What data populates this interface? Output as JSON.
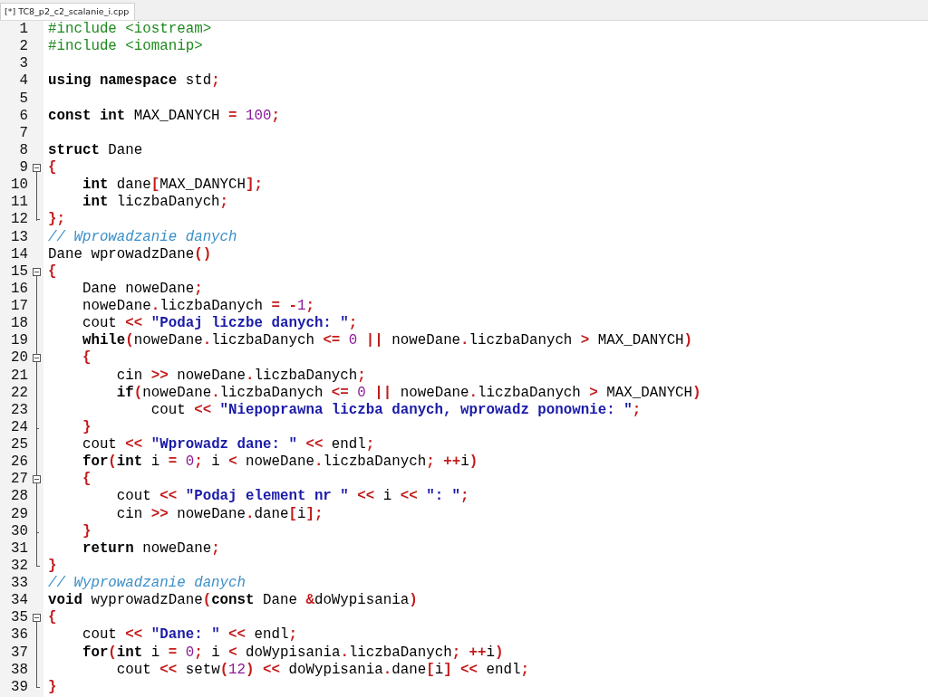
{
  "tab": {
    "title": "[*] TC8_p2_c2_scalanie_i.cpp",
    "selected": true
  },
  "lines": [
    {
      "number": "1",
      "kind": "plain",
      "tokens": [
        {
          "kind": "pre",
          "text": "#include <iostream>"
        }
      ]
    },
    {
      "number": "2",
      "kind": "plain",
      "tokens": [
        {
          "kind": "pre",
          "text": "#include <iomanip>"
        }
      ]
    },
    {
      "number": "3",
      "kind": "plain"
    },
    {
      "number": "4",
      "kind": "plain",
      "tokens": [
        {
          "kind": "kw",
          "text": "using"
        },
        {
          "kind": "kw",
          "text": " namespace"
        },
        {
          "kind": "plain",
          "text": " std"
        },
        {
          "kind": "sym",
          "text": ";"
        }
      ]
    },
    {
      "number": "5",
      "kind": "plain"
    },
    {
      "number": "6",
      "kind": "plain",
      "tokens": [
        {
          "kind": "kw",
          "text": "const"
        },
        {
          "kind": "kw",
          "text": " int"
        },
        {
          "kind": "plain",
          "text": " MAX_DANYCH "
        },
        {
          "kind": "sym",
          "text": "="
        },
        {
          "kind": "num",
          "text": " 100"
        },
        {
          "kind": "sym",
          "text": ";"
        }
      ]
    },
    {
      "number": "7",
      "kind": "plain"
    },
    {
      "number": "8",
      "kind": "plain",
      "tokens": [
        {
          "kind": "kw",
          "text": "struct"
        },
        {
          "kind": "plain",
          "text": " Dane"
        }
      ]
    },
    {
      "number": "9",
      "kind": "fold",
      "expanded": true,
      "tokens": [
        {
          "kind": "sym",
          "text": "{"
        }
      ]
    },
    {
      "number": "10",
      "kind": "inside",
      "tokens": [
        {
          "kind": "kw",
          "text": "    int"
        },
        {
          "kind": "plain",
          "text": " dane"
        },
        {
          "kind": "sym",
          "text": "["
        },
        {
          "kind": "plain",
          "text": "MAX_DANYCH"
        },
        {
          "kind": "sym",
          "text": "];"
        }
      ]
    },
    {
      "number": "11",
      "kind": "inside",
      "tokens": [
        {
          "kind": "kw",
          "text": "    int"
        },
        {
          "kind": "plain",
          "text": " liczbaDanych"
        },
        {
          "kind": "sym",
          "text": ";"
        }
      ]
    },
    {
      "number": "12",
      "kind": "close",
      "tokens": [
        {
          "kind": "sym",
          "text": "};"
        }
      ]
    },
    {
      "number": "13",
      "kind": "plain",
      "tokens": [
        {
          "kind": "com",
          "text": "// Wprowadzanie danych"
        }
      ]
    },
    {
      "number": "14",
      "kind": "plain",
      "tokens": [
        {
          "kind": "plain",
          "text": "Dane wprowadzDane"
        },
        {
          "kind": "sym",
          "text": "()"
        }
      ]
    },
    {
      "number": "15",
      "kind": "fold",
      "expanded": true,
      "tokens": [
        {
          "kind": "sym",
          "text": "{"
        }
      ]
    },
    {
      "number": "16",
      "kind": "inside",
      "tokens": [
        {
          "kind": "plain",
          "text": "    Dane noweDane"
        },
        {
          "kind": "sym",
          "text": ";"
        }
      ]
    },
    {
      "number": "17",
      "kind": "inside",
      "tokens": [
        {
          "kind": "plain",
          "text": "    noweDane"
        },
        {
          "kind": "sym",
          "text": "."
        },
        {
          "kind": "plain",
          "text": "liczbaDanych "
        },
        {
          "kind": "sym",
          "text": "="
        },
        {
          "kind": "sym",
          "text": " -"
        },
        {
          "kind": "num",
          "text": "1"
        },
        {
          "kind": "sym",
          "text": ";"
        }
      ]
    },
    {
      "number": "18",
      "kind": "inside",
      "tokens": [
        {
          "kind": "plain",
          "text": "    cout "
        },
        {
          "kind": "sym",
          "text": "<<"
        },
        {
          "kind": "str",
          "text": " \"Podaj liczbe danych: \""
        },
        {
          "kind": "sym",
          "text": ";"
        }
      ]
    },
    {
      "number": "19",
      "kind": "inside",
      "tokens": [
        {
          "kind": "kw",
          "text": "    while"
        },
        {
          "kind": "sym",
          "text": "("
        },
        {
          "kind": "plain",
          "text": "noweDane"
        },
        {
          "kind": "sym",
          "text": "."
        },
        {
          "kind": "plain",
          "text": "liczbaDanych "
        },
        {
          "kind": "sym",
          "text": "<="
        },
        {
          "kind": "num",
          "text": " 0"
        },
        {
          "kind": "sym",
          "text": " ||"
        },
        {
          "kind": "plain",
          "text": " noweDane"
        },
        {
          "kind": "sym",
          "text": "."
        },
        {
          "kind": "plain",
          "text": "liczbaDanych "
        },
        {
          "kind": "sym",
          "text": ">"
        },
        {
          "kind": "plain",
          "text": " MAX_DANYCH"
        },
        {
          "kind": "sym",
          "text": ")"
        }
      ]
    },
    {
      "number": "20",
      "kind": "subfold",
      "expanded": true,
      "tokens": [
        {
          "kind": "sym",
          "text": "    {"
        }
      ]
    },
    {
      "number": "21",
      "kind": "inside",
      "tokens": [
        {
          "kind": "plain",
          "text": "        cin "
        },
        {
          "kind": "sym",
          "text": ">>"
        },
        {
          "kind": "plain",
          "text": " noweDane"
        },
        {
          "kind": "sym",
          "text": "."
        },
        {
          "kind": "plain",
          "text": "liczbaDanych"
        },
        {
          "kind": "sym",
          "text": ";"
        }
      ]
    },
    {
      "number": "22",
      "kind": "inside",
      "tokens": [
        {
          "kind": "kw",
          "text": "        if"
        },
        {
          "kind": "sym",
          "text": "("
        },
        {
          "kind": "plain",
          "text": "noweDane"
        },
        {
          "kind": "sym",
          "text": "."
        },
        {
          "kind": "plain",
          "text": "liczbaDanych "
        },
        {
          "kind": "sym",
          "text": "<="
        },
        {
          "kind": "num",
          "text": " 0"
        },
        {
          "kind": "sym",
          "text": " ||"
        },
        {
          "kind": "plain",
          "text": " noweDane"
        },
        {
          "kind": "sym",
          "text": "."
        },
        {
          "kind": "plain",
          "text": "liczbaDanych "
        },
        {
          "kind": "sym",
          "text": ">"
        },
        {
          "kind": "plain",
          "text": " MAX_DANYCH"
        },
        {
          "kind": "sym",
          "text": ")"
        }
      ]
    },
    {
      "number": "23",
      "kind": "inside",
      "tokens": [
        {
          "kind": "plain",
          "text": "            cout "
        },
        {
          "kind": "sym",
          "text": "<<"
        },
        {
          "kind": "str",
          "text": " \"Niepoprawna liczba danych, wprowadz ponownie: \""
        },
        {
          "kind": "sym",
          "text": ";"
        }
      ]
    },
    {
      "number": "24",
      "kind": "subclose",
      "tokens": [
        {
          "kind": "sym",
          "text": "    }"
        }
      ]
    },
    {
      "number": "25",
      "kind": "inside",
      "tokens": [
        {
          "kind": "plain",
          "text": "    cout "
        },
        {
          "kind": "sym",
          "text": "<<"
        },
        {
          "kind": "str",
          "text": " \"Wprowadz dane: \""
        },
        {
          "kind": "sym",
          "text": " <<"
        },
        {
          "kind": "plain",
          "text": " endl"
        },
        {
          "kind": "sym",
          "text": ";"
        }
      ]
    },
    {
      "number": "26",
      "kind": "inside",
      "tokens": [
        {
          "kind": "kw",
          "text": "    for"
        },
        {
          "kind": "sym",
          "text": "("
        },
        {
          "kind": "kw",
          "text": "int"
        },
        {
          "kind": "plain",
          "text": " i "
        },
        {
          "kind": "sym",
          "text": "="
        },
        {
          "kind": "num",
          "text": " 0"
        },
        {
          "kind": "sym",
          "text": ";"
        },
        {
          "kind": "plain",
          "text": " i "
        },
        {
          "kind": "sym",
          "text": "<"
        },
        {
          "kind": "plain",
          "text": " noweDane"
        },
        {
          "kind": "sym",
          "text": "."
        },
        {
          "kind": "plain",
          "text": "liczbaDanych"
        },
        {
          "kind": "sym",
          "text": ";"
        },
        {
          "kind": "sym",
          "text": " ++"
        },
        {
          "kind": "plain",
          "text": "i"
        },
        {
          "kind": "sym",
          "text": ")"
        }
      ]
    },
    {
      "number": "27",
      "kind": "subfold",
      "expanded": true,
      "tokens": [
        {
          "kind": "sym",
          "text": "    {"
        }
      ]
    },
    {
      "number": "28",
      "kind": "inside",
      "tokens": [
        {
          "kind": "plain",
          "text": "        cout "
        },
        {
          "kind": "sym",
          "text": "<<"
        },
        {
          "kind": "str",
          "text": " \"Podaj element nr \""
        },
        {
          "kind": "sym",
          "text": " <<"
        },
        {
          "kind": "plain",
          "text": " i "
        },
        {
          "kind": "sym",
          "text": "<<"
        },
        {
          "kind": "str",
          "text": " \": \""
        },
        {
          "kind": "sym",
          "text": ";"
        }
      ]
    },
    {
      "number": "29",
      "kind": "inside",
      "tokens": [
        {
          "kind": "plain",
          "text": "        cin "
        },
        {
          "kind": "sym",
          "text": ">>"
        },
        {
          "kind": "plain",
          "text": " noweDane"
        },
        {
          "kind": "sym",
          "text": "."
        },
        {
          "kind": "plain",
          "text": "dane"
        },
        {
          "kind": "sym",
          "text": "["
        },
        {
          "kind": "plain",
          "text": "i"
        },
        {
          "kind": "sym",
          "text": "];"
        }
      ]
    },
    {
      "number": "30",
      "kind": "subclose",
      "tokens": [
        {
          "kind": "sym",
          "text": "    }"
        }
      ]
    },
    {
      "number": "31",
      "kind": "inside",
      "tokens": [
        {
          "kind": "kw",
          "text": "    return"
        },
        {
          "kind": "plain",
          "text": " noweDane"
        },
        {
          "kind": "sym",
          "text": ";"
        }
      ]
    },
    {
      "number": "32",
      "kind": "close",
      "tokens": [
        {
          "kind": "sym",
          "text": "}"
        }
      ]
    },
    {
      "number": "33",
      "kind": "plain",
      "tokens": [
        {
          "kind": "com",
          "text": "// Wyprowadzanie danych"
        }
      ]
    },
    {
      "number": "34",
      "kind": "plain",
      "tokens": [
        {
          "kind": "kw",
          "text": "void"
        },
        {
          "kind": "plain",
          "text": " wyprowadzDane"
        },
        {
          "kind": "sym",
          "text": "("
        },
        {
          "kind": "kw",
          "text": "const"
        },
        {
          "kind": "plain",
          "text": " Dane "
        },
        {
          "kind": "sym",
          "text": "&"
        },
        {
          "kind": "plain",
          "text": "doWypisania"
        },
        {
          "kind": "sym",
          "text": ")"
        }
      ]
    },
    {
      "number": "35",
      "kind": "fold",
      "expanded": true,
      "tokens": [
        {
          "kind": "sym",
          "text": "{"
        }
      ]
    },
    {
      "number": "36",
      "kind": "inside",
      "tokens": [
        {
          "kind": "plain",
          "text": "    cout "
        },
        {
          "kind": "sym",
          "text": "<<"
        },
        {
          "kind": "str",
          "text": " \"Dane: \""
        },
        {
          "kind": "sym",
          "text": " <<"
        },
        {
          "kind": "plain",
          "text": " endl"
        },
        {
          "kind": "sym",
          "text": ";"
        }
      ]
    },
    {
      "number": "37",
      "kind": "inside",
      "tokens": [
        {
          "kind": "kw",
          "text": "    for"
        },
        {
          "kind": "sym",
          "text": "("
        },
        {
          "kind": "kw",
          "text": "int"
        },
        {
          "kind": "plain",
          "text": " i "
        },
        {
          "kind": "sym",
          "text": "="
        },
        {
          "kind": "num",
          "text": " 0"
        },
        {
          "kind": "sym",
          "text": ";"
        },
        {
          "kind": "plain",
          "text": " i "
        },
        {
          "kind": "sym",
          "text": "<"
        },
        {
          "kind": "plain",
          "text": " doWypisania"
        },
        {
          "kind": "sym",
          "text": "."
        },
        {
          "kind": "plain",
          "text": "liczbaDanych"
        },
        {
          "kind": "sym",
          "text": ";"
        },
        {
          "kind": "sym",
          "text": " ++"
        },
        {
          "kind": "plain",
          "text": "i"
        },
        {
          "kind": "sym",
          "text": ")"
        }
      ]
    },
    {
      "number": "38",
      "kind": "inside",
      "tokens": [
        {
          "kind": "plain",
          "text": "        cout "
        },
        {
          "kind": "sym",
          "text": "<<"
        },
        {
          "kind": "plain",
          "text": " setw"
        },
        {
          "kind": "sym",
          "text": "("
        },
        {
          "kind": "num",
          "text": "12"
        },
        {
          "kind": "sym",
          "text": ")"
        },
        {
          "kind": "sym",
          "text": " <<"
        },
        {
          "kind": "plain",
          "text": " doWypisania"
        },
        {
          "kind": "sym",
          "text": "."
        },
        {
          "kind": "plain",
          "text": "dane"
        },
        {
          "kind": "sym",
          "text": "["
        },
        {
          "kind": "plain",
          "text": "i"
        },
        {
          "kind": "sym",
          "text": "]"
        },
        {
          "kind": "sym",
          "text": " <<"
        },
        {
          "kind": "plain",
          "text": " endl"
        },
        {
          "kind": "sym",
          "text": ";"
        }
      ]
    },
    {
      "number": "39",
      "kind": "close",
      "tokens": [
        {
          "kind": "sym",
          "text": "}"
        }
      ]
    }
  ]
}
